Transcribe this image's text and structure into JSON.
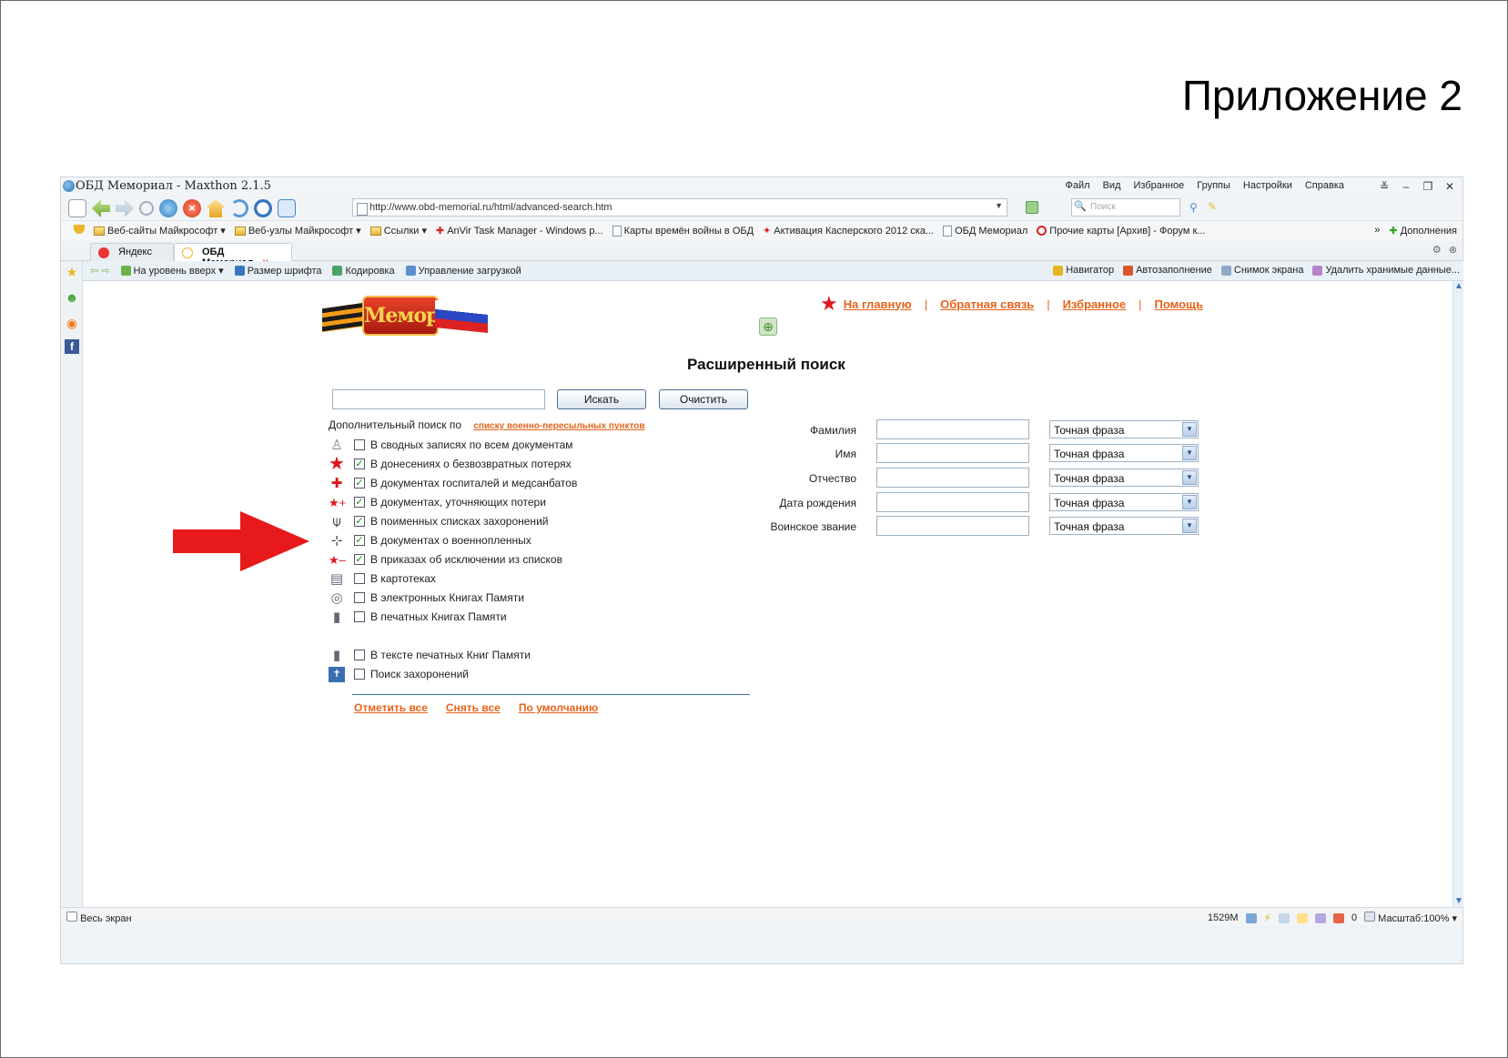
{
  "slide": {
    "title": "Приложение 2"
  },
  "window": {
    "title": "ОБД Мемориал - Maxthon 2.1.5",
    "menu": [
      "Файл",
      "Вид",
      "Избранное",
      "Группы",
      "Настройки",
      "Справка"
    ],
    "controls": [
      "≚",
      "–",
      "❐",
      "✕"
    ]
  },
  "toolbar": {
    "address": "http://www.obd-memorial.ru/html/advanced-search.htm",
    "search_placeholder": "Поиск"
  },
  "favorites": {
    "items": [
      {
        "label": "Веб-сайты Майкрософт ▾",
        "icon": "folder"
      },
      {
        "label": "Веб-узлы Майкрософт ▾",
        "icon": "folder"
      },
      {
        "label": "Ссылки ▾",
        "icon": "folder"
      },
      {
        "label": "AnVir Task Manager - Windows p...",
        "icon": "red"
      },
      {
        "label": "Карты времён войны в ОБД",
        "icon": "page"
      },
      {
        "label": "Активация Касперского 2012 ска...",
        "icon": "red"
      },
      {
        "label": "ОБД Мемориал",
        "icon": "page"
      },
      {
        "label": "Прочие карты [Архив] - Форум к...",
        "icon": "opera"
      }
    ],
    "more": "»",
    "addons": "Дополнения"
  },
  "tabs": [
    {
      "label": "Яндекс",
      "active": false
    },
    {
      "label": "ОБД Мемориал",
      "active": true
    }
  ],
  "navbar": {
    "left": [
      "На уровень вверх ▾",
      "Размер шрифта",
      "Кодировка",
      "Управление загрузкой"
    ],
    "right": [
      "Навигатор",
      "Автозаполнение",
      "Снимок экрана",
      "Удалить хранимые данные..."
    ]
  },
  "page": {
    "logo_text": "Мемориал",
    "top_links": [
      "На главную",
      "Обратная связь",
      "Избранное",
      "Помощь"
    ],
    "separator": "|",
    "heading": "Расширенный поиск",
    "search_button": "Искать",
    "clear_button": "Очистить",
    "extra_search_label": "Дополнительный поиск по",
    "extra_search_link": "списку военно-пересыльных пунктов",
    "checklist": [
      {
        "label": "В сводных записях по всем документам",
        "checked": false,
        "icon": "figure"
      },
      {
        "label": "В донесениях о безвозвратных потерях",
        "checked": true,
        "icon": "red-star"
      },
      {
        "label": "В документах госпиталей и медсанбатов",
        "checked": true,
        "icon": "red-cross"
      },
      {
        "label": "В документах, уточняющих потери",
        "checked": true,
        "icon": "star-plus"
      },
      {
        "label": "В поименных списках захоронений",
        "checked": true,
        "icon": "grave"
      },
      {
        "label": "В документах о военнопленных",
        "checked": true,
        "icon": "barbed"
      },
      {
        "label": "В приказах об исключении из списков",
        "checked": true,
        "icon": "star-minus"
      },
      {
        "label": "В картотеках",
        "checked": false,
        "icon": "card"
      },
      {
        "label": "В электронных Книгах Памяти",
        "checked": false,
        "icon": "disk"
      },
      {
        "label": "В печатных Книгах Памяти",
        "checked": false,
        "icon": "book"
      },
      {
        "label": "В тексте печатных Книг Памяти",
        "checked": false,
        "icon": "book"
      },
      {
        "label": "Поиск захоронений",
        "checked": false,
        "icon": "cemetery"
      }
    ],
    "bottom_links": [
      "Отметить все",
      "Снять все",
      "По умолчанию"
    ],
    "fields": [
      {
        "label": "Фамилия",
        "mode": "Точная фраза"
      },
      {
        "label": "Имя",
        "mode": "Точная фраза"
      },
      {
        "label": "Отчество",
        "mode": "Точная фраза"
      },
      {
        "label": "Дата рождения",
        "mode": "Точная фраза"
      },
      {
        "label": "Воинское звание",
        "mode": "Точная фраза"
      }
    ]
  },
  "statusbar": {
    "left": "Весь экран",
    "memory": "1529M",
    "count": "0",
    "zoom": "Масштаб:100% ▾"
  },
  "colors": {
    "link_orange": "#e8631a",
    "check_green": "#1a8c1a",
    "arrow_red": "#e8191b",
    "star_red": "#e1161d"
  }
}
